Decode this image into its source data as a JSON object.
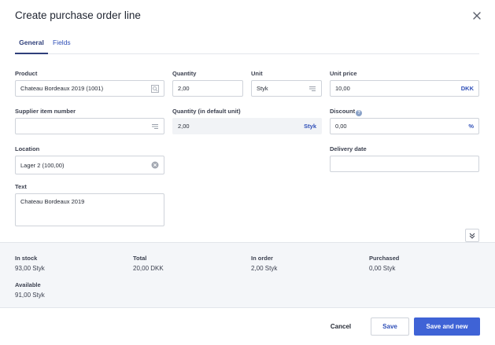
{
  "dialog": {
    "title": "Create purchase order line"
  },
  "tabs": [
    {
      "label": "General",
      "active": true
    },
    {
      "label": "Fields",
      "active": false
    }
  ],
  "form": {
    "product": {
      "label": "Product",
      "value": "Chateau Bordeaux 2019 (1001)",
      "icon": "lookup-icon"
    },
    "quantity": {
      "label": "Quantity",
      "value": "2,00"
    },
    "unit": {
      "label": "Unit",
      "value": "Styk",
      "icon": "list-icon"
    },
    "unit_price": {
      "label": "Unit price",
      "value": "10,00",
      "suffix": "DKK"
    },
    "supplier_item_number": {
      "label": "Supplier item number",
      "value": "",
      "icon": "list-icon"
    },
    "quantity_default": {
      "label": "Quantity (in default unit)",
      "value": "2,00",
      "suffix": "Styk"
    },
    "discount": {
      "label": "Discount",
      "value": "0,00",
      "suffix": "%",
      "icon": "info-icon"
    },
    "location": {
      "label": "Location",
      "value": "Lager 2 (100,00)",
      "icon": "clear-icon"
    },
    "delivery_date": {
      "label": "Delivery date",
      "value": ""
    },
    "text": {
      "label": "Text",
      "value": "Chateau Bordeaux 2019"
    }
  },
  "stats": {
    "in_stock": {
      "label": "In stock",
      "value": "93,00 Styk"
    },
    "total": {
      "label": "Total",
      "value": "20,00 DKK"
    },
    "in_order": {
      "label": "In order",
      "value": "2,00 Styk"
    },
    "purchased": {
      "label": "Purchased",
      "value": "0,00 Styk"
    },
    "available": {
      "label": "Available",
      "value": "91,00 Styk"
    }
  },
  "buttons": {
    "cancel": "Cancel",
    "save": "Save",
    "save_and_new": "Save and new"
  },
  "colors": {
    "primary": "#3f63d6",
    "link": "#3050b8",
    "tab_active": "#2f3f7a",
    "panel": "#f4f6f9"
  }
}
